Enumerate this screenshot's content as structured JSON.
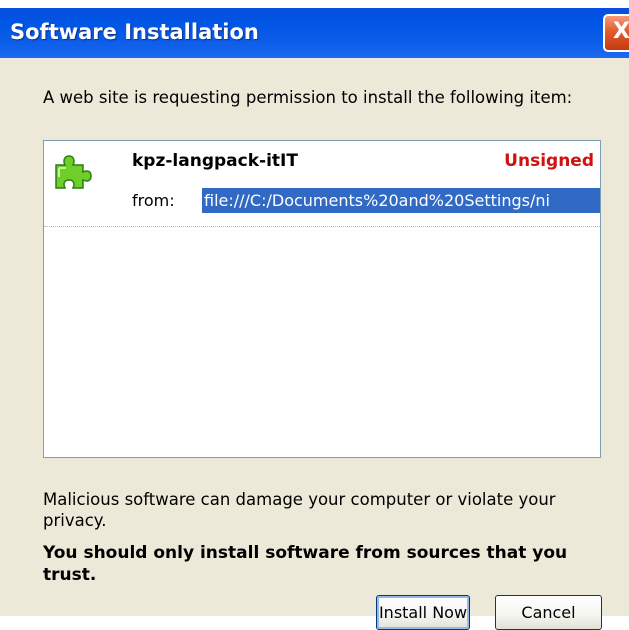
{
  "window": {
    "title": "Software Installation",
    "close_label": "X"
  },
  "dialog": {
    "intro": "A web site is requesting permission to install the following item:",
    "item": {
      "name": "kpz-langpack-itIT",
      "status": "Unsigned",
      "from_label": "from:",
      "from_url": "file:///C:/Documents%20and%20Settings/ni",
      "icon": "puzzle-piece-icon"
    },
    "warning": "Malicious software can damage your computer or violate your privacy.",
    "trust_warning": "You should only install software from sources that you trust.",
    "buttons": {
      "install": "Install Now",
      "cancel": "Cancel"
    }
  },
  "colors": {
    "titlebar": "#0054e3",
    "dialog_bg": "#ece9d8",
    "unsigned": "#d11010",
    "selection": "#316ac5"
  }
}
